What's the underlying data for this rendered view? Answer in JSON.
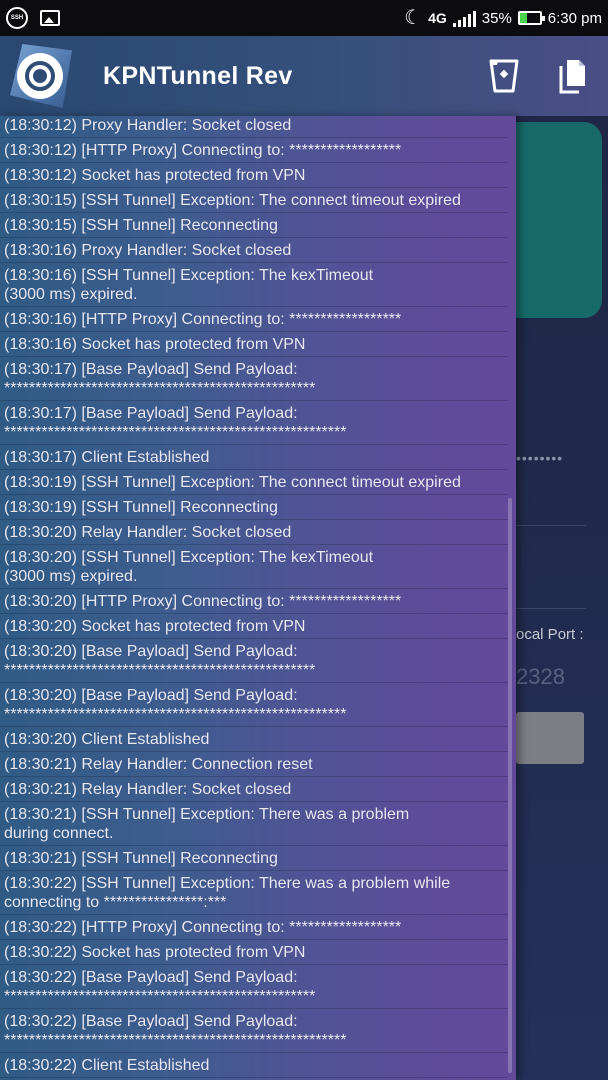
{
  "status_bar": {
    "battery": "35%",
    "time": "6:30 pm",
    "network": "4G",
    "ssh_badge": "SSH"
  },
  "toolbar": {
    "title": "KPNTunnel Rev",
    "icons": [
      "app-logo-icon",
      "clear-log-icon",
      "copy-log-icon"
    ]
  },
  "background": {
    "local_port_label": "ocal Port :",
    "local_port_value": "2328",
    "masked_value": "••••••••"
  },
  "log": {
    "entries": [
      "(18:30:12) Proxy Handler: Socket closed",
      "(18:30:12) [HTTP Proxy] Connecting to: ******************",
      "(18:30:12) Socket has protected from VPN",
      "(18:30:15) [SSH Tunnel] Exception: The connect timeout expired",
      "(18:30:15) [SSH Tunnel] Reconnecting",
      "(18:30:16) Proxy Handler: Socket closed",
      "(18:30:16) [SSH Tunnel] Exception: The kexTimeout\n(3000 ms) expired.",
      "(18:30:16) [HTTP Proxy] Connecting to: ******************",
      "(18:30:16) Socket has protected from VPN",
      "(18:30:17) [Base Payload] Send Payload:\n**************************************************",
      "(18:30:17) [Base Payload] Send Payload:\n*******************************************************",
      "(18:30:17) Client Established",
      "(18:30:19) [SSH Tunnel] Exception: The connect timeout expired",
      "(18:30:19) [SSH Tunnel] Reconnecting",
      "(18:30:20) Relay Handler: Socket closed",
      "(18:30:20) [SSH Tunnel] Exception: The kexTimeout\n(3000 ms) expired.",
      "(18:30:20) [HTTP Proxy] Connecting to: ******************",
      "(18:30:20) Socket has protected from VPN",
      "(18:30:20) [Base Payload] Send Payload:\n**************************************************",
      "(18:30:20) [Base Payload] Send Payload:\n*******************************************************",
      "(18:30:20) Client Established",
      "(18:30:21) Relay Handler: Connection reset",
      "(18:30:21) Relay Handler: Socket closed",
      "(18:30:21) [SSH Tunnel] Exception: There was a problem\nduring connect.",
      "(18:30:21) [SSH Tunnel] Reconnecting",
      "(18:30:22) [SSH Tunnel] Exception: There was a problem while\nconnecting to ****************:***",
      "(18:30:22) [HTTP Proxy] Connecting to: ******************",
      "(18:30:22) Socket has protected from VPN",
      "(18:30:22) [Base Payload] Send Payload:\n**************************************************",
      "(18:30:22) [Base Payload] Send Payload:\n*******************************************************",
      "(18:30:22) Client Established"
    ]
  }
}
